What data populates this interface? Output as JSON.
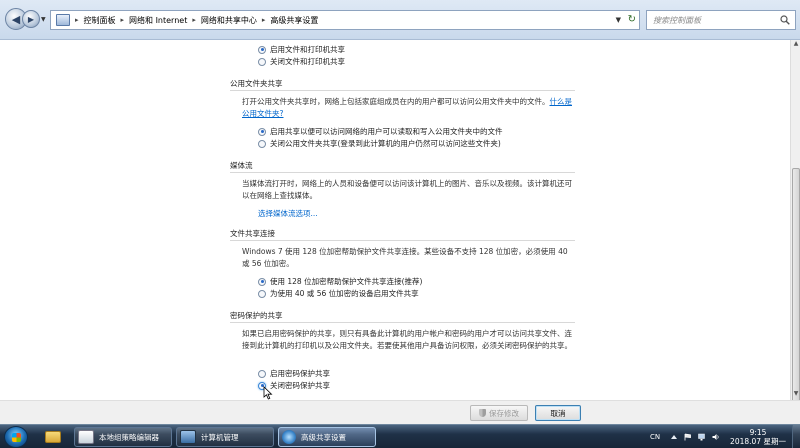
{
  "address_bar": {
    "crumbs": [
      "控制面板",
      "网络和 Internet",
      "网络和共享中心",
      "高级共享设置"
    ],
    "search_placeholder": "搜索控制面板"
  },
  "sections": {
    "file_printer": {
      "options": [
        {
          "label": "启用文件和打印机共享",
          "selected": true
        },
        {
          "label": "关闭文件和打印机共享",
          "selected": false
        }
      ]
    },
    "public_folder": {
      "title": "公用文件夹共享",
      "description": "打开公用文件夹共享时，网络上包括家庭组成员在内的用户都可以访问公用文件夹中的文件。",
      "link": "什么是公用文件夹?",
      "options": [
        {
          "label": "启用共享以便可以访问网络的用户可以读取和写入公用文件夹中的文件",
          "selected": true
        },
        {
          "label": "关闭公用文件夹共享(登录到此计算机的用户仍然可以访问这些文件夹)",
          "selected": false
        }
      ]
    },
    "media_streaming": {
      "title": "媒体流",
      "description": "当媒体流打开时，网络上的人员和设备便可以访问该计算机上的图片、音乐以及视频。该计算机还可以在网络上查找媒体。",
      "link": "选择媒体流选项..."
    },
    "file_sharing": {
      "title": "文件共享连接",
      "description": "Windows 7 使用 128 位加密帮助保护文件共享连接。某些设备不支持 128 位加密，必须使用 40 或 56 位加密。",
      "options": [
        {
          "label": "使用 128 位加密帮助保护文件共享连接(推荐)",
          "selected": true
        },
        {
          "label": "为使用 40 或 56 位加密的设备启用文件共享",
          "selected": false
        }
      ]
    },
    "password": {
      "title": "密码保护的共享",
      "description": "如果已启用密码保护的共享，则只有具备此计算机的用户帐户和密码的用户才可以访问共享文件、连接到此计算机的打印机以及公用文件夹。若要使其他用户具备访问权限，必须关闭密码保护的共享。",
      "options": [
        {
          "label": "启用密码保护共享",
          "selected": false
        },
        {
          "label": "关闭密码保护共享",
          "selected": true
        }
      ]
    }
  },
  "buttons": {
    "save": "保存修改",
    "cancel": "取消"
  },
  "taskbar": {
    "items": [
      "本地组策略编辑器",
      "计算机管理",
      "高级共享设置"
    ],
    "active": "高级共享设置",
    "lang": "CN",
    "time": "9:15",
    "date": "2018.07 星期一"
  }
}
